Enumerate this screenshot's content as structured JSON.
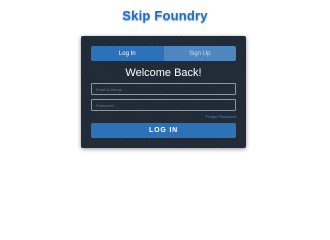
{
  "brand": {
    "title": "Skip Foundry"
  },
  "auth_card": {
    "tabs": [
      {
        "label": "Log In",
        "active": true
      },
      {
        "label": "Sign Up",
        "active": false
      }
    ],
    "heading": "Welcome Back!",
    "email": {
      "value": "",
      "placeholder": "Email Address"
    },
    "password": {
      "value": "",
      "placeholder": "Password"
    },
    "forgot_link": "Forgot Password",
    "submit_label": "LOG IN"
  },
  "colors": {
    "brand": "#1f6fc4",
    "card_bg": "#1f2a36",
    "accent": "#2d72b8",
    "tab_inactive": "#4e86c0",
    "link": "#3b86d4"
  }
}
